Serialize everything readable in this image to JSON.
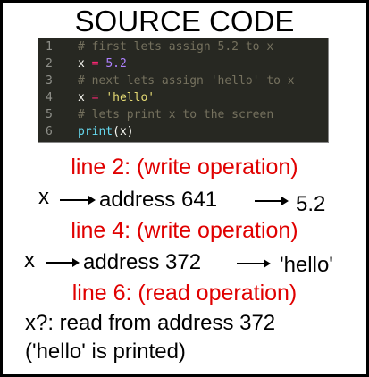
{
  "title": "SOURCE CODE",
  "code": {
    "lines": [
      {
        "n": "1",
        "comment": "# first lets assign 5.2 to x"
      },
      {
        "n": "2",
        "var": "x",
        "op": "=",
        "value": "5.2"
      },
      {
        "n": "3",
        "comment": "# next lets assign 'hello' to x"
      },
      {
        "n": "4",
        "var": "x",
        "op": "=",
        "value": "'hello'"
      },
      {
        "n": "5",
        "comment": "# lets print x to the screen"
      },
      {
        "n": "6",
        "fn": "print",
        "args": "(x)"
      }
    ]
  },
  "steps": [
    {
      "heading": "line 2: (write operation)",
      "var": "x",
      "address": "address 641",
      "value": "5.2"
    },
    {
      "heading": "line 4: (write operation)",
      "var": "x",
      "address": "address 372",
      "value": "'hello'"
    },
    {
      "heading": "line 6: (read operation)",
      "text1": "x?: read from address 372",
      "text2": "('hello' is printed)"
    }
  ]
}
